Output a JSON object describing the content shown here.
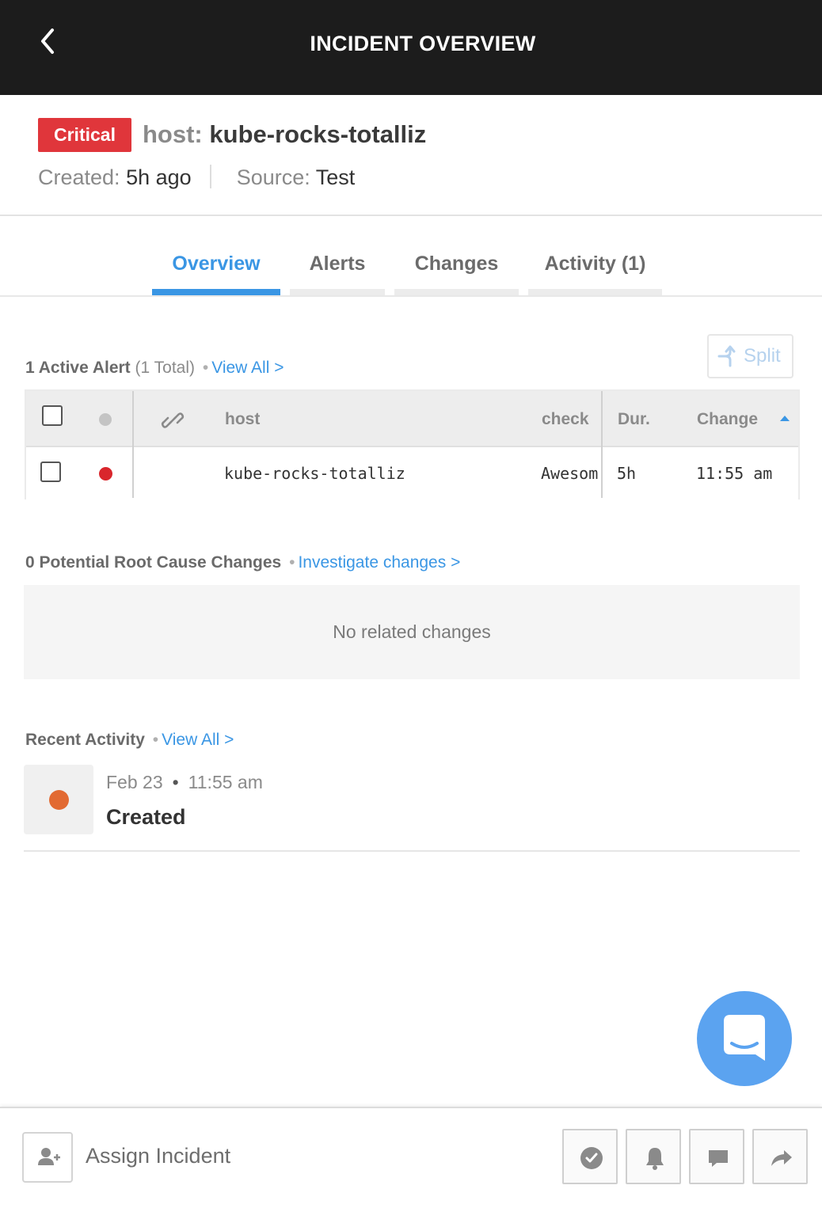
{
  "header": {
    "title": "INCIDENT OVERVIEW"
  },
  "incident": {
    "severity": "Critical",
    "title_key": "host:",
    "title_value": "kube-rocks-totalliz",
    "created_label": "Created:",
    "created_value": "5h ago",
    "source_label": "Source:",
    "source_value": "Test"
  },
  "tabs": [
    {
      "label": "Overview",
      "active": true
    },
    {
      "label": "Alerts"
    },
    {
      "label": "Changes"
    },
    {
      "label": "Activity (1)"
    }
  ],
  "alerts_section": {
    "count_label": "1 Active Alert",
    "total_label": "(1 Total)",
    "dot": "•",
    "view_all": "View All >",
    "split_label": "Split",
    "columns": [
      "host",
      "check",
      "Dur.",
      "Change"
    ],
    "rows": [
      {
        "status_color": "#d9262c",
        "host": "kube-rocks-totalliz",
        "check": "Awesom",
        "duration": "5h",
        "change": "11:55 am"
      }
    ]
  },
  "changes_section": {
    "label": "0 Potential Root Cause Changes",
    "dot": "•",
    "link": "Investigate changes >",
    "empty_text": "No related changes"
  },
  "activity_section": {
    "label": "Recent Activity",
    "dot": "•",
    "view_all": "View All >",
    "items": [
      {
        "date": "Feb 23",
        "bullet": "•",
        "time": "11:55 am",
        "event": "Created",
        "dot_color": "#e26a32"
      }
    ]
  },
  "bottom_bar": {
    "assign_label": "Assign Incident",
    "actions": [
      "check-circle-icon",
      "bell-icon",
      "comment-icon",
      "share-arrow-icon"
    ]
  },
  "colors": {
    "accent": "#3a96e4",
    "critical": "#e0363b",
    "header_bg": "#1c1c1c"
  }
}
